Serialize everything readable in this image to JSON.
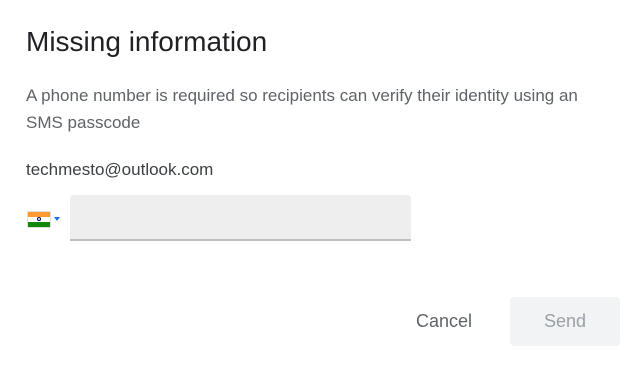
{
  "dialog": {
    "title": "Missing information",
    "description": "A phone number is required so recipients can verify their identity using an SMS passcode",
    "recipient_email": "techmesto@outlook.com",
    "phone": {
      "country_flag_icon": "india-flag-icon",
      "country_flag_colors": [
        "#ff9933",
        "#ffffff",
        "#138808"
      ],
      "value": "",
      "placeholder": ""
    },
    "buttons": {
      "cancel_label": "Cancel",
      "send_label": "Send",
      "send_enabled": false
    }
  },
  "colors": {
    "title_text": "#202124",
    "body_text": "#5f6368",
    "input_background": "#eeeeee",
    "input_underline": "#bdc1c6",
    "caret": "#1a73e8",
    "disabled_button_bg": "#f1f3f4",
    "disabled_button_text": "#9aa0a6"
  }
}
